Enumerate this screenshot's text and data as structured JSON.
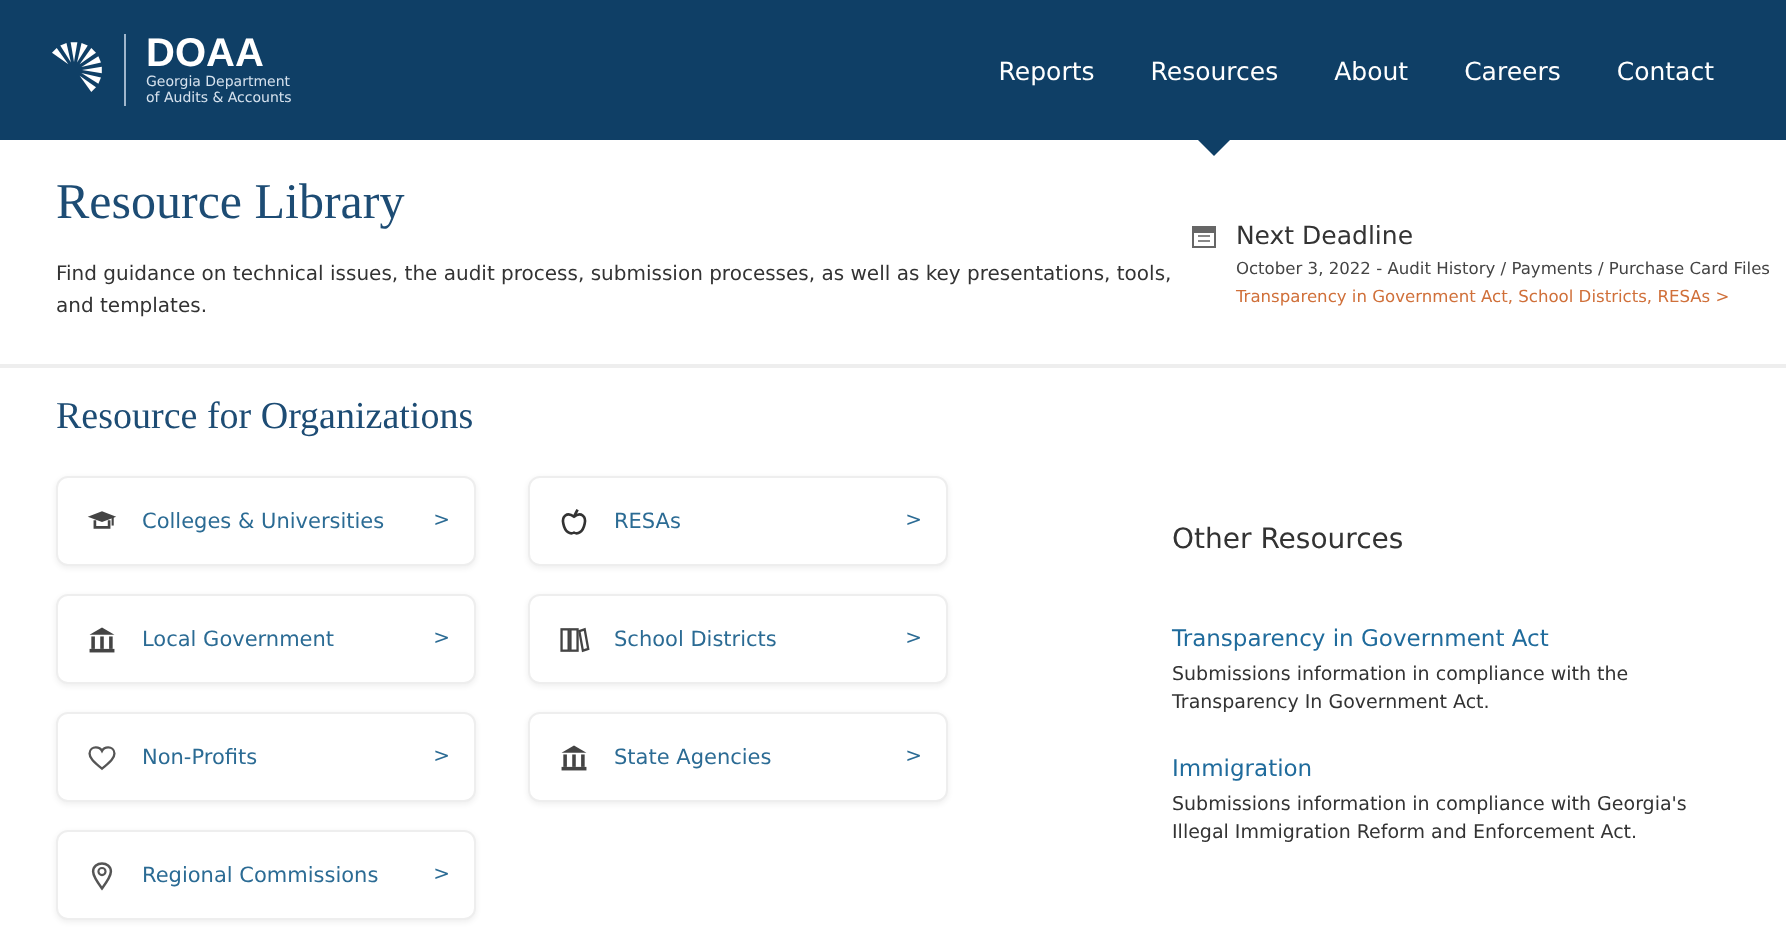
{
  "header": {
    "logo": {
      "title": "DOAA",
      "subtitle_lines": [
        "Georgia Department",
        "of Audits & Accounts"
      ]
    },
    "nav": [
      {
        "label": "Reports",
        "selected": false
      },
      {
        "label": "Resources",
        "selected": true
      },
      {
        "label": "About",
        "selected": false
      },
      {
        "label": "Careers",
        "selected": false
      },
      {
        "label": "Contact",
        "selected": false
      }
    ]
  },
  "intro": {
    "title": "Resource Library",
    "description": "Find guidance on technical issues, the audit process, submission processes, as well as key presentations, tools, and templates."
  },
  "deadline": {
    "title": "Next Deadline",
    "date_line": "October 3, 2022 - Audit History / Payments / Purchase Card Files",
    "link": "Transparency in Government Act, School Districts, RESAs",
    "link_arrow": ">"
  },
  "organizations": {
    "title": "Resource for Organizations",
    "cards": [
      {
        "label": "Colleges & Universities",
        "kind": "graduation",
        "arrow": ">"
      },
      {
        "label": "RESAs",
        "kind": "apple",
        "arrow": ">"
      },
      {
        "label": "Local Government",
        "kind": "building",
        "arrow": ">"
      },
      {
        "label": "School Districts",
        "kind": "books",
        "arrow": ">"
      },
      {
        "label": "Non-Profits",
        "kind": "heart",
        "arrow": ">"
      },
      {
        "label": "State Agencies",
        "kind": "building",
        "arrow": ">"
      },
      {
        "label": "Regional Commissions",
        "kind": "pin",
        "arrow": ">"
      }
    ]
  },
  "other_resources": {
    "title": "Other Resources",
    "items": [
      {
        "title": "Transparency in Government Act",
        "description": "Submissions information in compliance with the Transparency In Government Act."
      },
      {
        "title": "Immigration",
        "description": "Submissions information in compliance with Georgia's Illegal Immigration Reform and Enforcement Act."
      }
    ]
  }
}
